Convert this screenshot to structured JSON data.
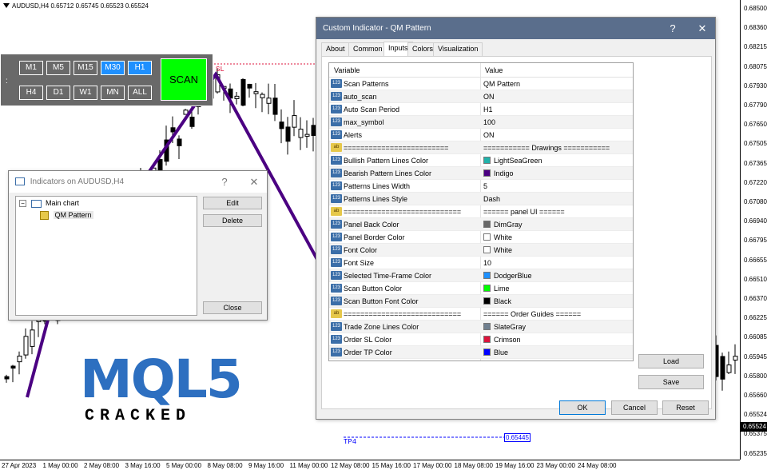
{
  "chart": {
    "symbol_line": "AUDUSD,H4  0.65712 0.65745 0.65523 0.65524",
    "prices": [
      "0.68500",
      "0.68360",
      "0.68215",
      "0.68075",
      "0.67930",
      "0.67790",
      "0.67650",
      "0.67505",
      "0.67365",
      "0.67220",
      "0.67080",
      "0.66940",
      "0.66795",
      "0.66655",
      "0.66510",
      "0.66370",
      "0.66225",
      "0.66085",
      "0.65945",
      "0.65800",
      "0.65660",
      "0.65524",
      "0.65375",
      "0.65235"
    ],
    "current_price": "0.65524",
    "time_labels": [
      "27 Apr 2023",
      "1 May 00:00",
      "2 May 08:00",
      "3 May 16:00",
      "5 May 00:00",
      "8 May 08:00",
      "9 May 16:00",
      "11 May 00:00",
      "12 May 08:00",
      "15 May 16:00",
      "17 May 00:00",
      "18 May 08:00",
      "19 May 16:00",
      "23 May 00:00",
      "24 May 08:00"
    ],
    "sl_label": "SL",
    "tp_label": "TP4",
    "tp_price": "0.65445",
    "watermark_top": "MQL5",
    "watermark_bottom": "CRACKED",
    "pattern_color": "#4b0082"
  },
  "scan_panel": {
    "handle": ":",
    "timeframes_row1": [
      "M1",
      "M5",
      "M15",
      "M30",
      "H1"
    ],
    "timeframes_row2": [
      "H4",
      "D1",
      "W1",
      "MN",
      "ALL"
    ],
    "selected": [
      "M30",
      "H1"
    ],
    "scan_label": "SCAN",
    "colors": {
      "panel": "#696969",
      "selected": "#1e90ff",
      "scan": "#00ff00"
    }
  },
  "indicators_window": {
    "title": "Indicators on AUDUSD,H4",
    "help": "?",
    "close": "✕",
    "tree_root": "Main chart",
    "tree_child": "QM Pattern",
    "edit_label": "Edit",
    "delete_label": "Delete",
    "close_label": "Close"
  },
  "custom_window": {
    "title": "Custom Indicator - QM Pattern",
    "help": "?",
    "close": "✕",
    "tabs": [
      "About",
      "Common",
      "Inputs",
      "Colors",
      "Visualization"
    ],
    "active_tab": "Inputs",
    "col_variable": "Variable",
    "col_value": "Value",
    "rows": [
      {
        "icon": "123",
        "var": "Scan Patterns",
        "val": "QM Pattern"
      },
      {
        "icon": "123",
        "var": "auto_scan",
        "val": "ON"
      },
      {
        "icon": "123",
        "var": "Auto Scan Period",
        "val": "H1"
      },
      {
        "icon": "123",
        "var": "max_symbol",
        "val": "100"
      },
      {
        "icon": "123",
        "var": "Alerts",
        "val": "ON"
      },
      {
        "icon": "ab",
        "var": "=========================",
        "val": "=========== Drawings ==========="
      },
      {
        "icon": "123",
        "var": "Bullish Pattern Lines Color",
        "val": "LightSeaGreen",
        "swatch": "#20b2aa"
      },
      {
        "icon": "123",
        "var": "Bearish Pattern Lines Color",
        "val": "Indigo",
        "swatch": "#4b0082"
      },
      {
        "icon": "123",
        "var": "Patterns Lines Width",
        "val": "5"
      },
      {
        "icon": "123",
        "var": "Patterns Lines Style",
        "val": "Dash"
      },
      {
        "icon": "ab",
        "var": "============================",
        "val": "====== panel UI ======"
      },
      {
        "icon": "123",
        "var": "Panel Back Color",
        "val": "DimGray",
        "swatch": "#696969"
      },
      {
        "icon": "123",
        "var": "Panel Border Color",
        "val": "White",
        "swatch": "#ffffff"
      },
      {
        "icon": "123",
        "var": "Font Color",
        "val": "White",
        "swatch": "#ffffff"
      },
      {
        "icon": "123",
        "var": "Font Size",
        "val": "10"
      },
      {
        "icon": "123",
        "var": "Selected Time-Frame Color",
        "val": "DodgerBlue",
        "swatch": "#1e90ff"
      },
      {
        "icon": "123",
        "var": "Scan Button Color",
        "val": "Lime",
        "swatch": "#00ff00"
      },
      {
        "icon": "123",
        "var": "Scan Button Font Color",
        "val": "Black",
        "swatch": "#000000"
      },
      {
        "icon": "ab",
        "var": "============================",
        "val": "====== Order Guides ======"
      },
      {
        "icon": "123",
        "var": "Trade Zone Lines Color",
        "val": "SlateGray",
        "swatch": "#708090"
      },
      {
        "icon": "123",
        "var": "Order SL Color",
        "val": "Crimson",
        "swatch": "#dc143c"
      },
      {
        "icon": "123",
        "var": "Order TP Color",
        "val": "Blue",
        "swatch": "#0000ff"
      }
    ],
    "load_label": "Load",
    "save_label": "Save",
    "ok_label": "OK",
    "cancel_label": "Cancel",
    "reset_label": "Reset"
  }
}
